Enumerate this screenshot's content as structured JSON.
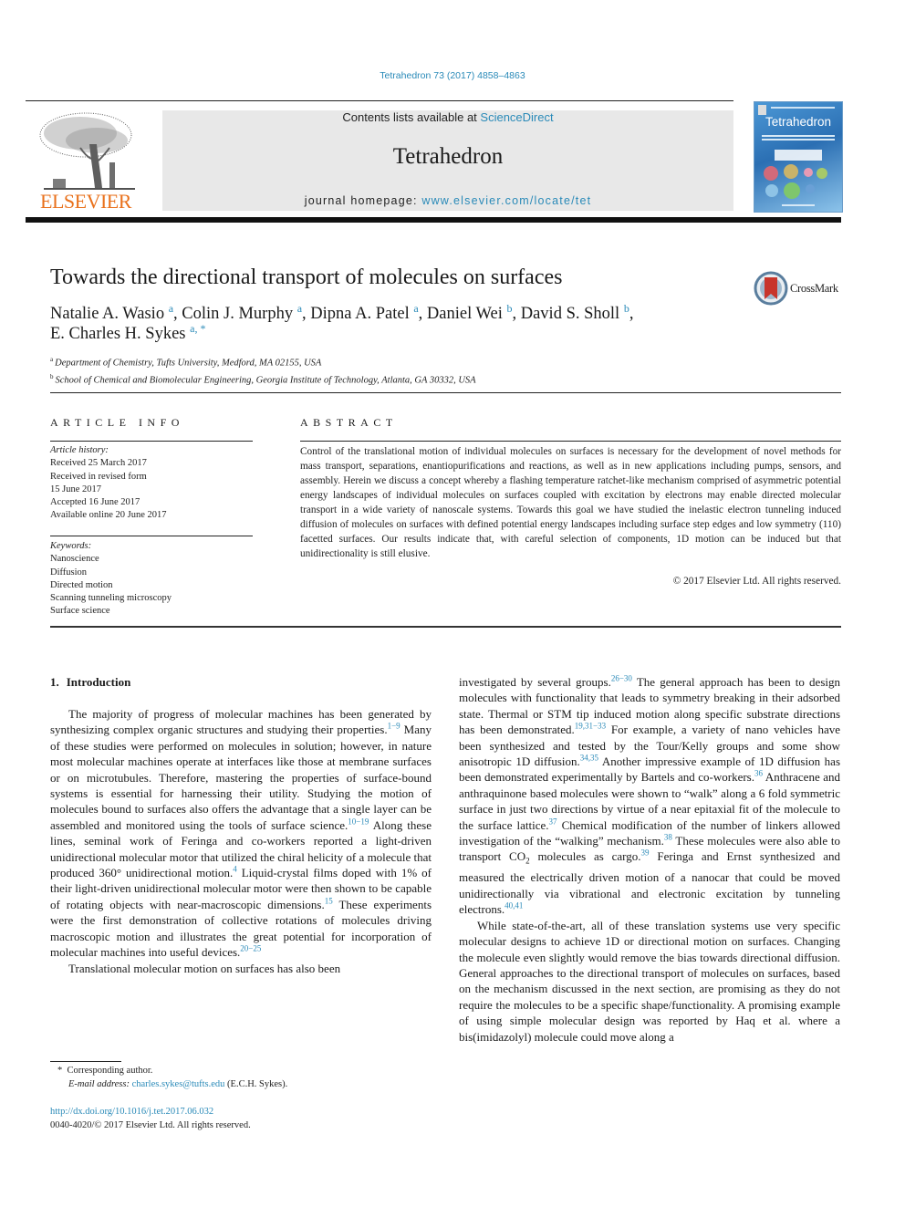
{
  "header": {
    "citation": "Tetrahedron 73 (2017) 4858–4863",
    "contents_prefix": "Contents lists available at ",
    "contents_link": "ScienceDirect",
    "journal_title": "Tetrahedron",
    "homepage_prefix": "journal homepage: ",
    "homepage_link": "www.elsevier.com/locate/tet",
    "publisher_logo": "ELSEVIER",
    "cover_title": "Tetrahedron",
    "crossmark_label": "CrossMark"
  },
  "article": {
    "title": "Towards the directional transport of molecules on surfaces",
    "authors": [
      {
        "name": "Natalie A. Wasio",
        "mark": "a",
        "sep": ", "
      },
      {
        "name": "Colin J. Murphy",
        "mark": "a",
        "sep": ", "
      },
      {
        "name": "Dipna A. Patel",
        "mark": "a",
        "sep": ", "
      },
      {
        "name": "Daniel Wei",
        "mark": "b",
        "sep": ", "
      },
      {
        "name": "David S. Sholl",
        "mark": "b",
        "sep": ","
      },
      {
        "name": "E. Charles H. Sykes",
        "mark": "a, *",
        "sep": ""
      }
    ],
    "affiliations": [
      {
        "mark": "a",
        "text": "Department of Chemistry, Tufts University, Medford, MA 02155, USA"
      },
      {
        "mark": "b",
        "text": "School of Chemical and Biomolecular Engineering, Georgia Institute of Technology, Atlanta, GA 30332, USA"
      }
    ]
  },
  "article_info": {
    "heading": "ARTICLE INFO",
    "history_label": "Article history:",
    "history": [
      "Received 25 March 2017",
      "Received in revised form",
      "15 June 2017",
      "Accepted 16 June 2017",
      "Available online 20 June 2017"
    ],
    "keywords_label": "Keywords:",
    "keywords": [
      "Nanoscience",
      "Diffusion",
      "Directed motion",
      "Scanning tunneling microscopy",
      "Surface science"
    ]
  },
  "abstract": {
    "heading": "ABSTRACT",
    "text": "Control of the translational motion of individual molecules on surfaces is necessary for the development of novel methods for mass transport, separations, enantiopurifications and reactions, as well as in new applications including pumps, sensors, and assembly. Herein we discuss a concept whereby a flashing temperature ratchet-like mechanism comprised of asymmetric potential energy landscapes of individual molecules on surfaces coupled with excitation by electrons may enable directed molecular transport in a wide variety of nanoscale systems. Towards this goal we have studied the inelastic electron tunneling induced diffusion of molecules on surfaces with defined potential energy landscapes including surface step edges and low symmetry (110) facetted surfaces. Our results indicate that, with careful selection of components, 1D motion can be induced but that unidirectionality is still elusive.",
    "copyright": "© 2017 Elsevier Ltd. All rights reserved."
  },
  "introduction": {
    "number": "1.",
    "heading": "Introduction",
    "left_paragraphs": [
      [
        {
          "t": "The majority of progress of molecular machines has been generated by synthesizing complex organic structures and studying their properties."
        },
        {
          "ref": "1−9"
        },
        {
          "t": " Many of these studies were performed on molecules in solution; however, in nature most molecular machines operate at interfaces like those at membrane surfaces or on microtubules. Therefore, mastering the properties of surface-bound systems is essential for harnessing their utility. Studying the motion of molecules bound to surfaces also offers the advantage that a single layer can be assembled and monitored using the tools of surface science."
        },
        {
          "ref": "10−19"
        },
        {
          "t": " Along these lines, seminal work of Feringa and co-workers reported a light-driven unidirectional molecular motor that utilized the chiral helicity of a molecule that produced 360° unidirectional motion."
        },
        {
          "ref": "4"
        },
        {
          "t": " Liquid-crystal films doped with 1% of their light-driven unidirectional molecular motor were then shown to be capable of rotating objects with near-macroscopic dimensions."
        },
        {
          "ref": "15"
        },
        {
          "t": " These experiments were the first demonstration of collective rotations of molecules driving macroscopic motion and illustrates the great potential for incorporation of molecular machines into useful devices."
        },
        {
          "ref": "20−25"
        }
      ],
      [
        {
          "t": "Translational molecular motion on surfaces has also been"
        }
      ]
    ],
    "right_paragraphs": [
      [
        {
          "t": "investigated by several groups."
        },
        {
          "ref": "26−30"
        },
        {
          "t": " The general approach has been to design molecules with functionality that leads to symmetry breaking in their adsorbed state. Thermal or STM tip induced motion along specific substrate directions has been demonstrated."
        },
        {
          "ref": "19,31−33"
        },
        {
          "t": " For example, a variety of nano vehicles have been synthesized and tested by the Tour/Kelly groups and some show anisotropic 1D diffusion."
        },
        {
          "ref": "34,35"
        },
        {
          "t": " Another impressive example of 1D diffusion has been demonstrated experimentally by Bartels and co-workers."
        },
        {
          "ref": "36"
        },
        {
          "t": " Anthracene and anthraquinone based molecules were shown to “walk” along a 6 fold symmetric surface in just two directions by virtue of a near epitaxial fit of the molecule to the surface lattice."
        },
        {
          "ref": "37"
        },
        {
          "t": " Chemical modification of the number of linkers allowed investigation of the “walking” mechanism."
        },
        {
          "ref": "38"
        },
        {
          "t": " These molecules were also able to transport CO"
        },
        {
          "sub": "2"
        },
        {
          "t": " molecules as cargo."
        },
        {
          "ref": "39"
        },
        {
          "t": " Feringa and Ernst synthesized and measured the electrically driven motion of a nanocar that could be moved unidirectionally via vibrational and electronic excitation by tunneling electrons."
        },
        {
          "ref": "40,41"
        }
      ],
      [
        {
          "t": "While state-of-the-art, all of these translation systems use very specific molecular designs to achieve 1D or directional motion on surfaces. Changing the molecule even slightly would remove the bias towards directional diffusion. General approaches to the directional transport of molecules on surfaces, based on the mechanism discussed in the next section, are promising as they do not require the molecules to be a specific shape/functionality. A promising example of using simple molecular design was reported by Haq et al. where a bis(imidazolyl) molecule could move along a"
        }
      ]
    ]
  },
  "footnotes": {
    "corresponding_mark": "*",
    "corresponding": "Corresponding author.",
    "email_label": "E-mail address:",
    "email": "charles.sykes@tufts.edu",
    "email_suffix": " (E.C.H. Sykes).",
    "doi": "http://dx.doi.org/10.1016/j.tet.2017.06.032",
    "issn_copyright": "0040-4020/© 2017 Elsevier Ltd. All rights reserved."
  },
  "colors": {
    "link": "#2a8ab8",
    "elsevier_orange": "#e9711c",
    "masthead_bg": "#e8e8e8",
    "crossmark_red": "#c8352b"
  }
}
